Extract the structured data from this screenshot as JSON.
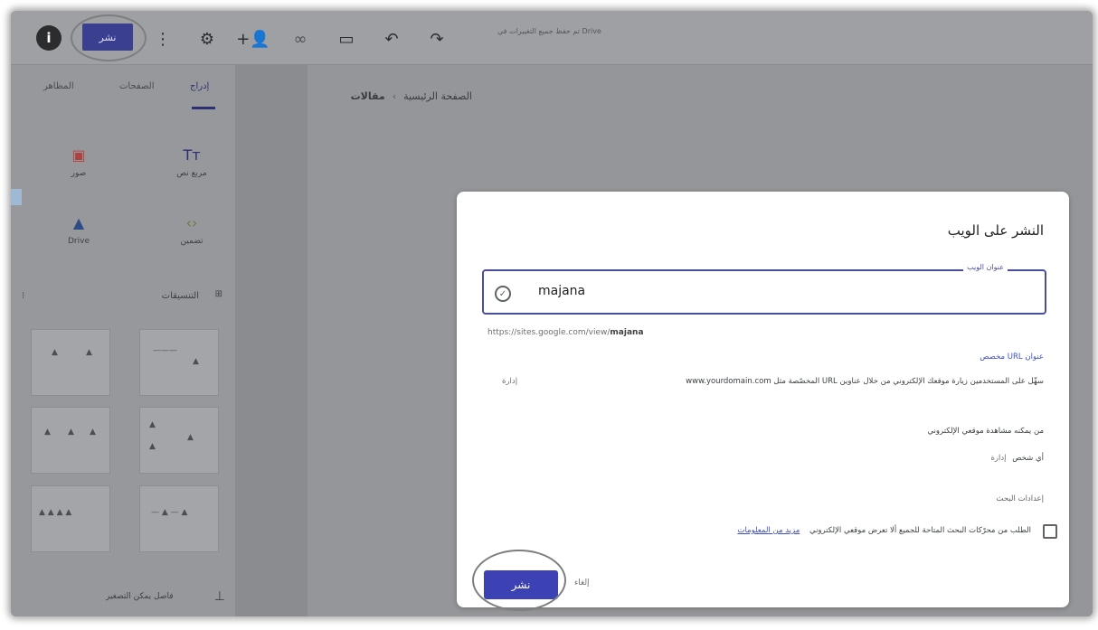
{
  "topbar": {
    "info_label": "i",
    "publish_label": "نشر",
    "hint": "تم حفظ جميع التغييرات في Drive",
    "icons": [
      "more-vert-icon",
      "settings-icon",
      "add-person-icon",
      "link-icon",
      "preview-icon",
      "undo-icon",
      "redo-icon"
    ]
  },
  "sidebar": {
    "tabs": [
      {
        "label": "إدراج"
      },
      {
        "label": "الصفحات"
      },
      {
        "label": "المظاهر"
      }
    ],
    "tools": [
      {
        "label": "مربع نص"
      },
      {
        "label": "صور"
      },
      {
        "label": "تضمين"
      },
      {
        "label": "Drive"
      }
    ],
    "section_title": "التنسيقات",
    "bottom_label": "فاصل يمكن التصغير"
  },
  "canvas": {
    "breadcrumb": {
      "home": "الصفحة الرئيسية",
      "current": "مقالات"
    }
  },
  "dialog": {
    "title": "النشر على الويب",
    "web_address_label": "عنوان الويب",
    "web_address_value": "majana",
    "url_prefix": "https://sites.google.com/view/",
    "url_name": "majana",
    "custom_url_title": "عنوان URL مخصص",
    "custom_url_desc": "سهِّل على المستخدمين زيارة موقعك الإلكتروني من خلال عناوين URL المخصّصة مثل www.yourdomain.com",
    "manage_1": "إدارة",
    "who_can_view_title": "من يمكنه مشاهدة موقعي الإلكتروني",
    "who_can_view_value": "أي شخص",
    "manage_2": "إدارة",
    "search_settings_title": "إعدادات البحث",
    "search_checkbox_label": "الطلب من محرّكات البحث المتاحة للجميع ألا تعرض موقعي الإلكتروني",
    "learn_more": "مزيد من المعلومات",
    "publish_button": "نشر",
    "cancel_button": "إلغاء"
  }
}
